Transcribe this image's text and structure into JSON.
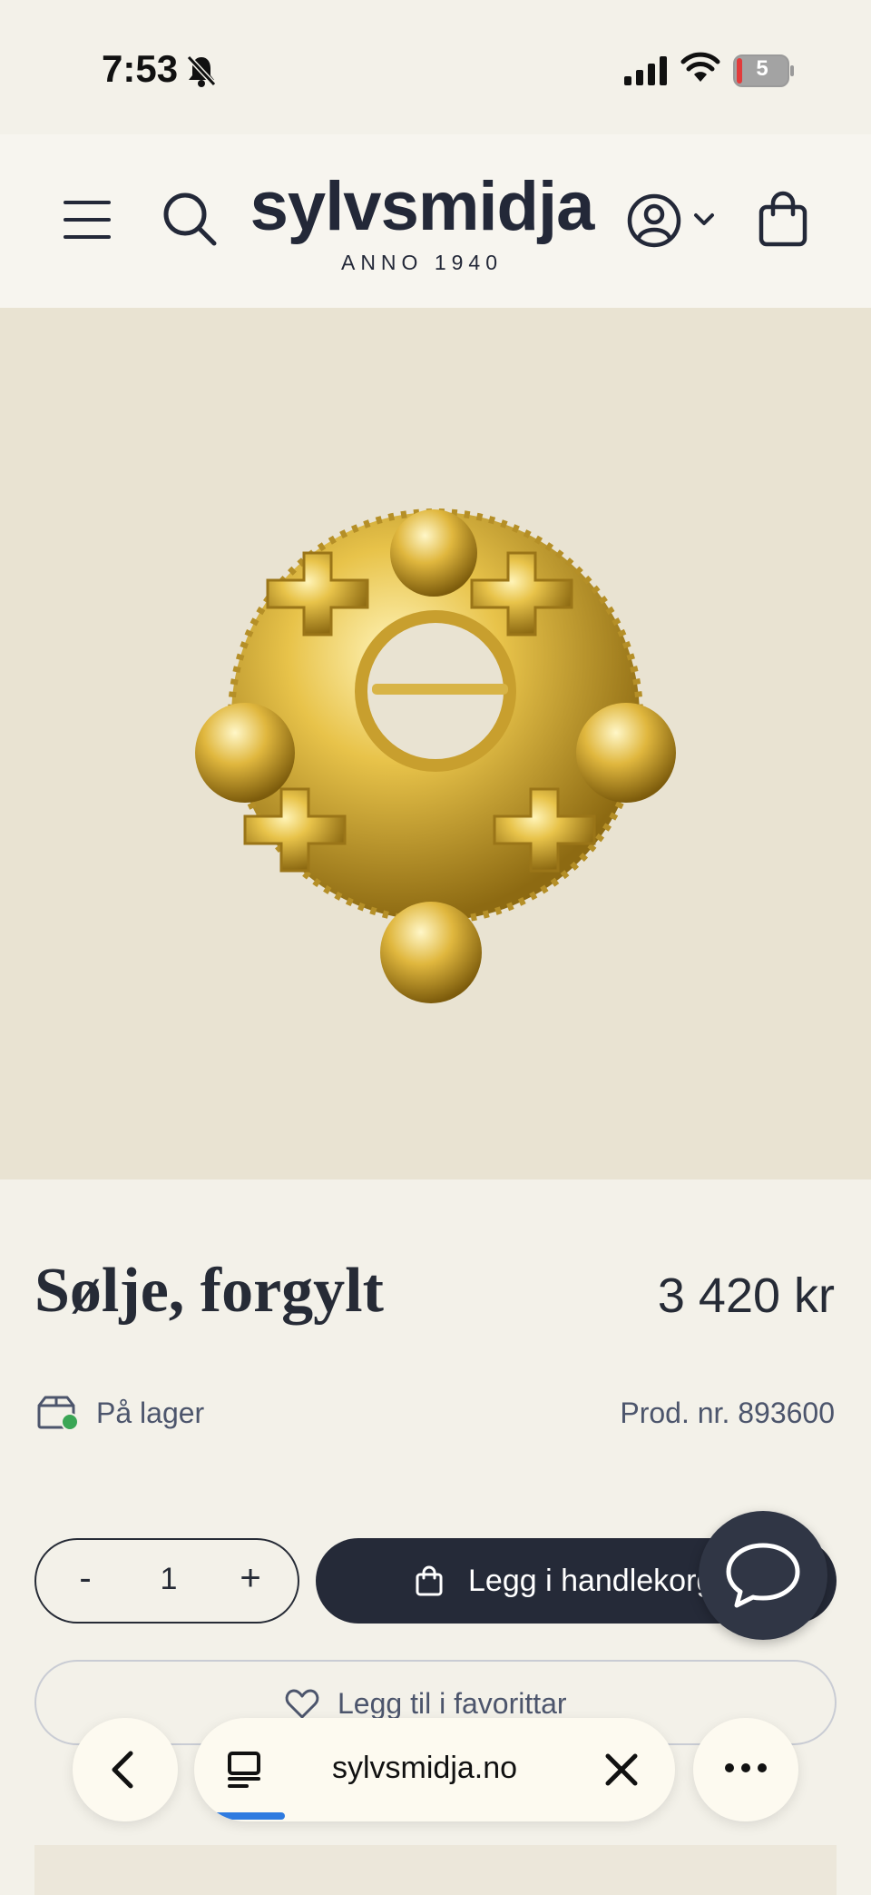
{
  "status_bar": {
    "time": "7:53",
    "battery_level": "5",
    "icons": [
      "bell-slash-icon",
      "cellular-signal-icon",
      "wifi-icon",
      "battery-icon"
    ]
  },
  "header": {
    "logo_text": "sylvsmidja",
    "logo_sub": "ANNO 1940",
    "icons": [
      "menu-icon",
      "search-icon",
      "account-icon",
      "chevron-down-icon",
      "shopping-bag-icon"
    ]
  },
  "product": {
    "title": "Sølje, forgylt",
    "price": "3 420 kr",
    "stock": "På lager",
    "product_number": "Prod. nr. 893600",
    "quantity": "1",
    "qty_minus": "-",
    "qty_plus": "+",
    "add_to_cart": "Legg i handlekorg",
    "add_to_favorites": "Legg til i favorittar"
  },
  "browser": {
    "url": "sylvsmidja.no",
    "load_progress": 0.15
  },
  "colors": {
    "page_bg": "#f3f1e9",
    "image_bg": "#e9e3d2",
    "primary_dark": "#252a38",
    "stock_green": "#3aa655",
    "progress_blue": "#2f7be0"
  }
}
